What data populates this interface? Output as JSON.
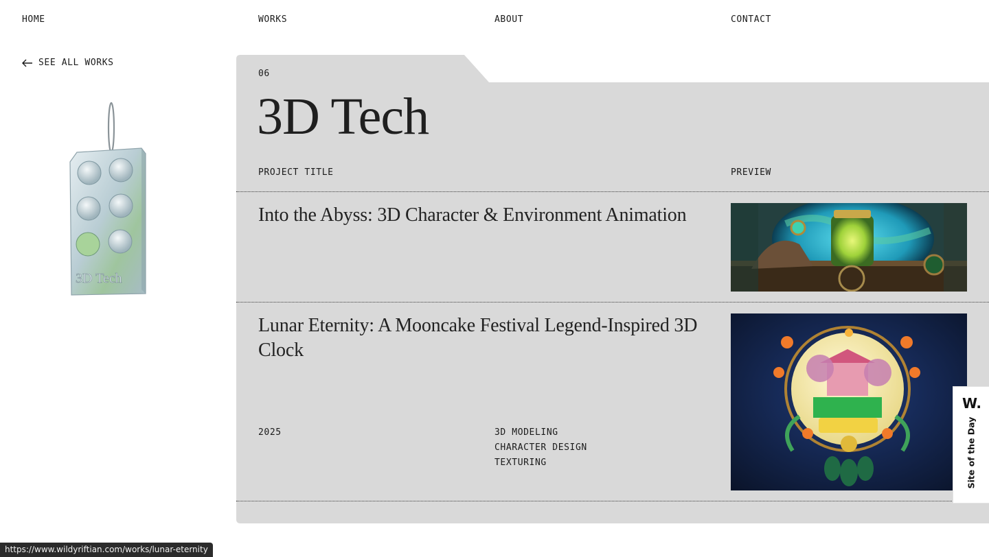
{
  "nav": {
    "home": "HOME",
    "works": "WORKS",
    "about": "ABOUT",
    "contact": "CONTACT"
  },
  "back_link": {
    "label": "SEE ALL WORKS",
    "icon": "arrow-left-icon"
  },
  "category": {
    "number": "06",
    "title": "3D Tech",
    "pendant_text": "3D Tech"
  },
  "columns": {
    "project_title": "PROJECT TITLE",
    "preview": "PREVIEW"
  },
  "projects": [
    {
      "title": "Into the Abyss: 3D Character & Environment Animation"
    },
    {
      "title": "Lunar Eternity: A Mooncake Festival Legend-Inspired 3D Clock",
      "year": "2025",
      "tags": [
        "3D MODELING",
        "CHARACTER DESIGN",
        "TEXTURING"
      ]
    }
  ],
  "badge": {
    "logo": "W.",
    "text": "Site of the Day"
  },
  "status_bar": {
    "url": "https://www.wildyriftian.com/works/lunar-eternity"
  },
  "colors": {
    "panel": "#d9d9d9",
    "text": "#1a1a1a",
    "background": "#ffffff"
  }
}
